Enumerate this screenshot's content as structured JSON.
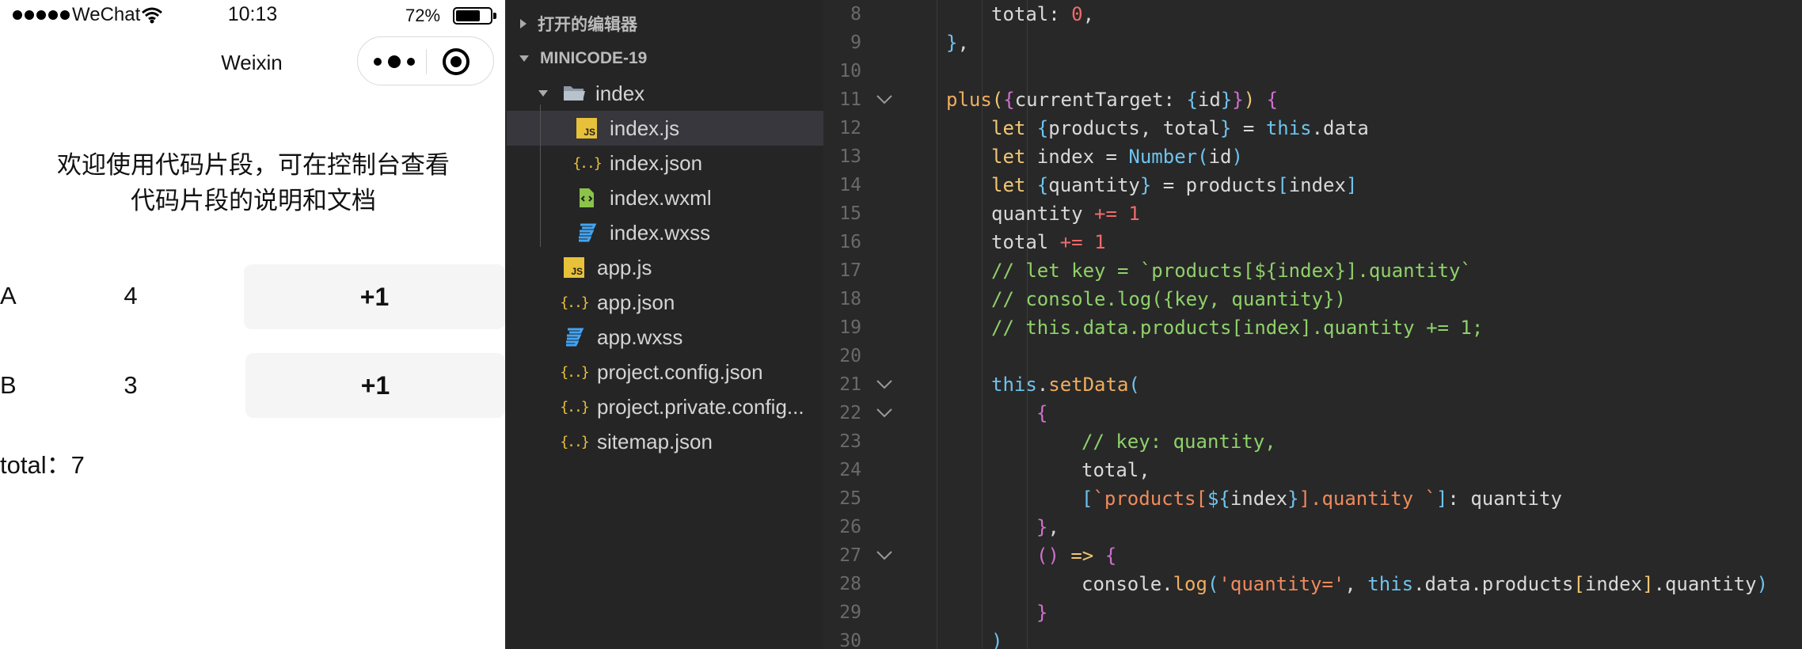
{
  "phone": {
    "status": {
      "carrier": "WeChat",
      "time": "10:13",
      "battery_pct": "72%",
      "battery_level": 0.72
    },
    "nav_title": "Weixin",
    "welcome_line1": "欢迎使用代码片段，可在控制台查看",
    "welcome_line2": "代码片段的说明和文档",
    "products": [
      {
        "name": "A",
        "quantity": "4",
        "button": "+1"
      },
      {
        "name": "B",
        "quantity": "3",
        "button": "+1"
      }
    ],
    "total": "total：7"
  },
  "explorer": {
    "open_editors": "打开的编辑器",
    "project": "MINICODE-19",
    "items": [
      {
        "label": "index",
        "type": "folder"
      },
      {
        "label": "index.js",
        "type": "js"
      },
      {
        "label": "index.json",
        "type": "json"
      },
      {
        "label": "index.wxml",
        "type": "wxml"
      },
      {
        "label": "index.wxss",
        "type": "wxss"
      },
      {
        "label": "app.js",
        "type": "js"
      },
      {
        "label": "app.json",
        "type": "json"
      },
      {
        "label": "app.wxss",
        "type": "wxss"
      },
      {
        "label": "project.config.json",
        "type": "json"
      },
      {
        "label": "project.private.config...",
        "type": "json"
      },
      {
        "label": "sitemap.json",
        "type": "json"
      }
    ]
  },
  "editor": {
    "lines": [
      {
        "n": "8",
        "indent": 2,
        "tokens": [
          [
            "total",
            "prop"
          ],
          [
            ": ",
            "pu"
          ],
          [
            "0",
            "num"
          ],
          [
            ",",
            "pu"
          ]
        ]
      },
      {
        "n": "9",
        "indent": 1,
        "tokens": [
          [
            "}",
            "br3"
          ],
          [
            ",",
            "pu"
          ]
        ]
      },
      {
        "n": "10",
        "indent": 0,
        "tokens": []
      },
      {
        "n": "11",
        "indent": 1,
        "fold": true,
        "tokens": [
          [
            "plus",
            "fn"
          ],
          [
            "(",
            "br1"
          ],
          [
            "{",
            "br2"
          ],
          [
            "currentTarget",
            "prop"
          ],
          [
            ": ",
            "pu"
          ],
          [
            "{",
            "br3"
          ],
          [
            "id",
            "prop"
          ],
          [
            "}",
            "br3"
          ],
          [
            "}",
            "br2"
          ],
          [
            ")",
            "br1"
          ],
          [
            " ",
            "pu"
          ],
          [
            "{",
            "br2"
          ]
        ]
      },
      {
        "n": "12",
        "indent": 2,
        "tokens": [
          [
            "let ",
            "kw"
          ],
          [
            "{",
            "br3"
          ],
          [
            "products",
            "plain"
          ],
          [
            ", ",
            "pu"
          ],
          [
            "total",
            "plain"
          ],
          [
            "}",
            "br3"
          ],
          [
            " = ",
            "pu"
          ],
          [
            "this",
            "cl"
          ],
          [
            ".data",
            "plain"
          ]
        ]
      },
      {
        "n": "13",
        "indent": 2,
        "tokens": [
          [
            "let ",
            "kw"
          ],
          [
            "index",
            "plain"
          ],
          [
            " = ",
            "pu"
          ],
          [
            "Number",
            "cl"
          ],
          [
            "(",
            "br3"
          ],
          [
            "id",
            "plain"
          ],
          [
            ")",
            "br3"
          ]
        ]
      },
      {
        "n": "14",
        "indent": 2,
        "tokens": [
          [
            "let ",
            "kw"
          ],
          [
            "{",
            "br3"
          ],
          [
            "quantity",
            "plain"
          ],
          [
            "}",
            "br3"
          ],
          [
            " = ",
            "pu"
          ],
          [
            "products",
            "plain"
          ],
          [
            "[",
            "br3"
          ],
          [
            "index",
            "plain"
          ],
          [
            "]",
            "br3"
          ]
        ]
      },
      {
        "n": "15",
        "indent": 2,
        "tokens": [
          [
            "quantity ",
            "plain"
          ],
          [
            "+=",
            "num"
          ],
          [
            " ",
            "pu"
          ],
          [
            "1",
            "num"
          ]
        ]
      },
      {
        "n": "16",
        "indent": 2,
        "tokens": [
          [
            "total ",
            "plain"
          ],
          [
            "+=",
            "num"
          ],
          [
            " ",
            "pu"
          ],
          [
            "1",
            "num"
          ]
        ]
      },
      {
        "n": "17",
        "indent": 2,
        "tokens": [
          [
            "// let key = `products[${index}].quantity`",
            "cm"
          ]
        ]
      },
      {
        "n": "18",
        "indent": 2,
        "tokens": [
          [
            "// console.log({key, quantity})",
            "cm"
          ]
        ]
      },
      {
        "n": "19",
        "indent": 2,
        "tokens": [
          [
            "// this.data.products[index].quantity += 1;",
            "cm"
          ]
        ]
      },
      {
        "n": "20",
        "indent": 0,
        "tokens": []
      },
      {
        "n": "21",
        "indent": 2,
        "fold": true,
        "tokens": [
          [
            "this",
            "cl"
          ],
          [
            ".",
            "pu"
          ],
          [
            "setData",
            "fn"
          ],
          [
            "(",
            "br3"
          ]
        ]
      },
      {
        "n": "22",
        "indent": 3,
        "fold": true,
        "tokens": [
          [
            "{",
            "br2"
          ]
        ]
      },
      {
        "n": "23",
        "indent": 4,
        "tokens": [
          [
            "// key: quantity,",
            "cm"
          ]
        ]
      },
      {
        "n": "24",
        "indent": 4,
        "tokens": [
          [
            "total",
            "prop"
          ],
          [
            ",",
            "pu"
          ]
        ]
      },
      {
        "n": "25",
        "indent": 4,
        "tokens": [
          [
            "[",
            "br3"
          ],
          [
            "`products[",
            "str"
          ],
          [
            "${",
            "cl"
          ],
          [
            "index",
            "plain"
          ],
          [
            "}",
            "cl"
          ],
          [
            "].quantity `",
            "str"
          ],
          [
            "]",
            "br3"
          ],
          [
            ": ",
            "pu"
          ],
          [
            "quantity",
            "plain"
          ]
        ]
      },
      {
        "n": "26",
        "indent": 3,
        "tokens": [
          [
            "}",
            "br2"
          ],
          [
            ",",
            "pu"
          ]
        ]
      },
      {
        "n": "27",
        "indent": 3,
        "fold": true,
        "tokens": [
          [
            "()",
            "br2"
          ],
          [
            " => ",
            "kw"
          ],
          [
            "{",
            "br2"
          ]
        ]
      },
      {
        "n": "28",
        "indent": 4,
        "tokens": [
          [
            "console",
            "plain"
          ],
          [
            ".",
            "pu"
          ],
          [
            "log",
            "fn"
          ],
          [
            "(",
            "br3"
          ],
          [
            "'quantity='",
            "str"
          ],
          [
            ", ",
            "pu"
          ],
          [
            "this",
            "cl"
          ],
          [
            ".data.products",
            "plain"
          ],
          [
            "[",
            "br1"
          ],
          [
            "index",
            "plain"
          ],
          [
            "]",
            "br1"
          ],
          [
            ".quantity",
            "plain"
          ],
          [
            ")",
            "br3"
          ]
        ]
      },
      {
        "n": "29",
        "indent": 3,
        "tokens": [
          [
            "}",
            "br2"
          ]
        ]
      },
      {
        "n": "30",
        "indent": 2,
        "tokens": [
          [
            ")",
            "br3"
          ]
        ]
      }
    ]
  }
}
